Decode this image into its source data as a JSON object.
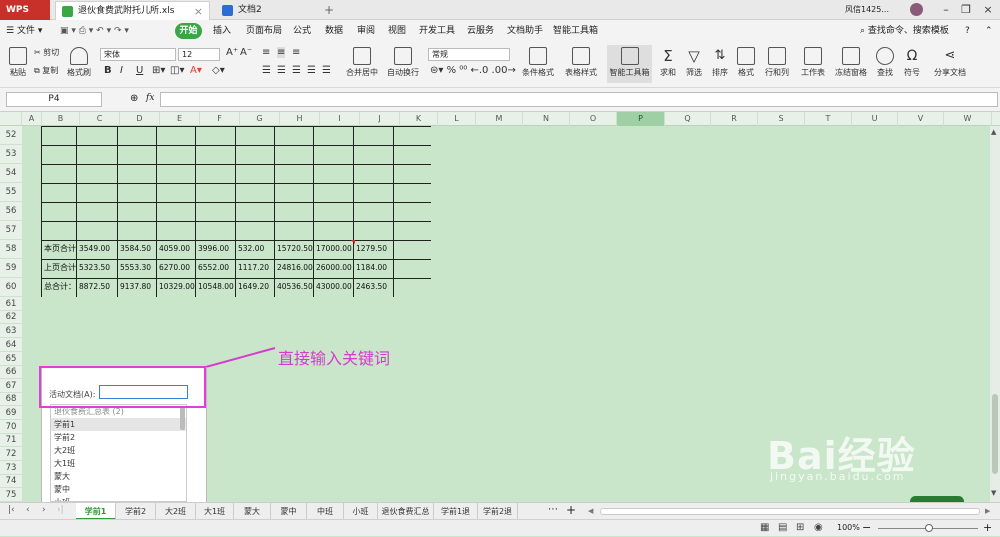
{
  "title_bar": {
    "app_label": "WPS",
    "tabs": [
      {
        "label": "退伙食费武附托儿所.xls",
        "active": true
      },
      {
        "label": "文档2",
        "active": false
      }
    ],
    "user": "风信1425..."
  },
  "menu": {
    "file": "文件",
    "start": "开始",
    "items": [
      "插入",
      "页面布局",
      "公式",
      "数据",
      "审阅",
      "视图",
      "开发工具",
      "云服务",
      "文档助手",
      "智能工具箱"
    ],
    "search": "查找命令、搜索模板"
  },
  "ribbon": {
    "paste": "粘贴",
    "cut": "剪切",
    "copy": "复制",
    "format_painter": "格式刷",
    "font_name": "宋体",
    "font_size": "12",
    "merge": "合并居中",
    "wrap": "自动换行",
    "number_format": "常规",
    "conditional": "条件格式",
    "table_style": "表格样式",
    "smart_toolbox": "智能工具箱",
    "sum": "求和",
    "filter": "筛选",
    "sort": "排序",
    "format": "格式",
    "rowcol": "行和列",
    "sheet": "工作表",
    "freeze": "冻结窗格",
    "find": "查找",
    "symbol": "符号",
    "share": "分享文档"
  },
  "formula_bar": {
    "name_box": "P4",
    "fx": "fx"
  },
  "columns": [
    "A",
    "B",
    "C",
    "D",
    "E",
    "F",
    "G",
    "H",
    "I",
    "J",
    "K",
    "L",
    "M",
    "N",
    "O",
    "P",
    "Q",
    "R",
    "S",
    "T",
    "U",
    "V",
    "W"
  ],
  "rows": [
    "52",
    "53",
    "54",
    "55",
    "56",
    "57",
    "58",
    "59",
    "60",
    "61",
    "62",
    "63",
    "64",
    "65",
    "66",
    "67",
    "68",
    "69",
    "70",
    "71",
    "72",
    "73",
    "74",
    "75"
  ],
  "table": [
    {
      "label": "本页合计",
      "values": [
        "3549.00",
        "3584.50",
        "4059.00",
        "3996.00",
        "532.00",
        "15720.50",
        "17000.00",
        "1279.50"
      ]
    },
    {
      "label": "上页合计",
      "values": [
        "5323.50",
        "5553.30",
        "6270.00",
        "6552.00",
        "1117.20",
        "24816.00",
        "26000.00",
        "1184.00"
      ]
    },
    {
      "label": "总合计：",
      "values": [
        "8872.50",
        "9137.80",
        "10329.00",
        "10548.00",
        "1649.20",
        "40536.50",
        "43000.00",
        "2463.50"
      ]
    }
  ],
  "popup": {
    "label": "活动文档(A):",
    "input_value": "",
    "items": [
      "退伙食费汇总表 (2)",
      "学前1",
      "学前2",
      "大2班",
      "大1班",
      "蒙大",
      "蒙中",
      "小班"
    ]
  },
  "annotation": "直接输入关键词",
  "sheet_tabs": [
    "学前1",
    "学前2",
    "大2班",
    "大1班",
    "蒙大",
    "蒙中",
    "中班",
    "小班",
    "退伙食费汇总表",
    "学前1退",
    "学前2退"
  ],
  "active_sheet": "学前1",
  "status": {
    "zoom": "100%"
  },
  "watermark": {
    "main": "Bai经验",
    "sub": "jingyan.baidu.com"
  },
  "colors": {
    "accent": "#2f9b38",
    "annotation": "#e23ed7",
    "sheet_bg": "#c9e5ca"
  }
}
